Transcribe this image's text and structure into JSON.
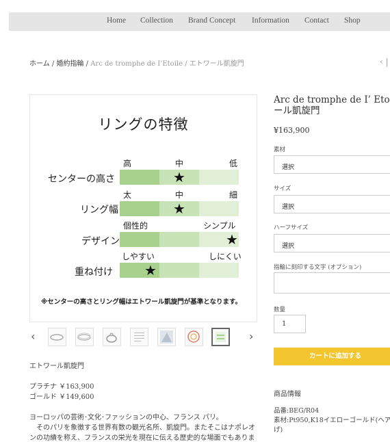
{
  "nav": {
    "items": [
      "Home",
      "Collection",
      "Brand Concept",
      "Information",
      "Contact",
      "Shop"
    ]
  },
  "breadcrumb": {
    "home": "ホーム",
    "sep": "/",
    "category": "婚約指輪",
    "collection": "Arc de tromphe de I’Etoile",
    "current": "エトワール凱旋門",
    "prev": "‹ |"
  },
  "feature_chart": {
    "title": "リングの特徴",
    "rows": [
      {
        "label": "センターの高さ",
        "levels": [
          "高",
          "中",
          "低"
        ],
        "selected": 2
      },
      {
        "label": "リング幅",
        "levels": [
          "太",
          "中",
          "細"
        ],
        "selected": 2
      },
      {
        "label": "デザイン",
        "levels": [
          "個性的",
          "シンプル"
        ],
        "selected": 3
      },
      {
        "label": "重ね付け",
        "levels": [
          "しやすい",
          "しにくい"
        ],
        "selected": 1
      }
    ],
    "star": "★",
    "note": "※センターの高さとリング幅はエトワール凱旋門が基準となります。"
  },
  "gallery": {
    "prev_arrow": "‹",
    "next_arrow": "›",
    "thumb_count": 7,
    "selected_thumb": 7
  },
  "description": {
    "name": "エトワール凱旋門",
    "platinum": "プラチナ ￥163,900",
    "gold": "ゴールド ￥149,600",
    "text1": "ヨーロッパの芸術･文化･ファッションの中心、フランス パリ。",
    "text2": "　そのパリを象徴する世界有数の観光名所、凱旋門。またそこはナポレオ",
    "text3": "ンの功績を称え、フランスの栄光を現在に伝える歴史的な場面でもありま"
  },
  "product": {
    "title_line1": "Arc de tromphe de I’ Etoile",
    "title_line2": "ール凱旋門",
    "price": "¥163,900",
    "material_label": "素材",
    "size_label": "サイズ",
    "halfsize_label": "ハーフサイズ",
    "engrave_label": "指輪に刻印する文字 (オプション)",
    "select_placeholder": "選択",
    "qty_label": "数量",
    "qty_value": "1",
    "cart_button": "カートに追加する",
    "info_heading": "商品情報",
    "info_code": "品番:BEG/R04",
    "info_material": "素材:Pt950,K18イエローゴールド(ヘア",
    "info_material_cont": "げ)"
  },
  "colors": {
    "accent": "#f3c52f",
    "nav_bg": "#e5e5e5",
    "green_dark": "#a8d18d",
    "green_mid": "#c8e3b6",
    "green_light": "#e1efd6"
  }
}
